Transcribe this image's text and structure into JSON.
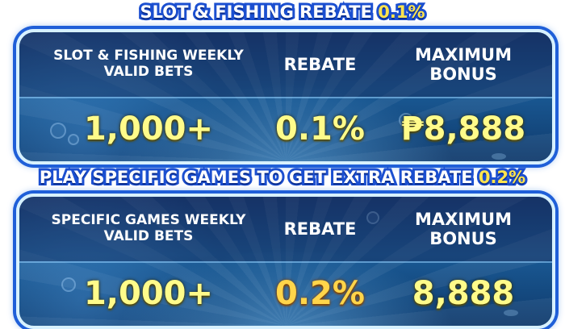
{
  "sections": [
    {
      "headline": {
        "text": "SLOT & FISHING REBATE",
        "rate": "0.1%"
      },
      "table": {
        "headers": [
          "SLOT & FISHING WEEKLY VALID BETS",
          "REBATE",
          "MAXIMUM BONUS"
        ],
        "values": [
          "1,000+",
          "0.1%",
          "₱8,888"
        ]
      }
    },
    {
      "headline": {
        "text": "PLAY SPECIFIC GAMES TO GET EXTRA REBATE",
        "rate": "0.2%"
      },
      "table": {
        "headers": [
          "SPECIFIC GAMES WEEKLY VALID BETS",
          "REBATE",
          "MAXIMUM BONUS"
        ],
        "values": [
          "1,000+",
          "0.2%",
          "8,888"
        ]
      }
    }
  ],
  "colors": {
    "headline_stroke": "#1b4fd0",
    "headline_rate": "#ffe44d",
    "value_text": "#fffb8a",
    "value_highlight": "#ffd54a",
    "panel_border": "#d7f1ff"
  }
}
